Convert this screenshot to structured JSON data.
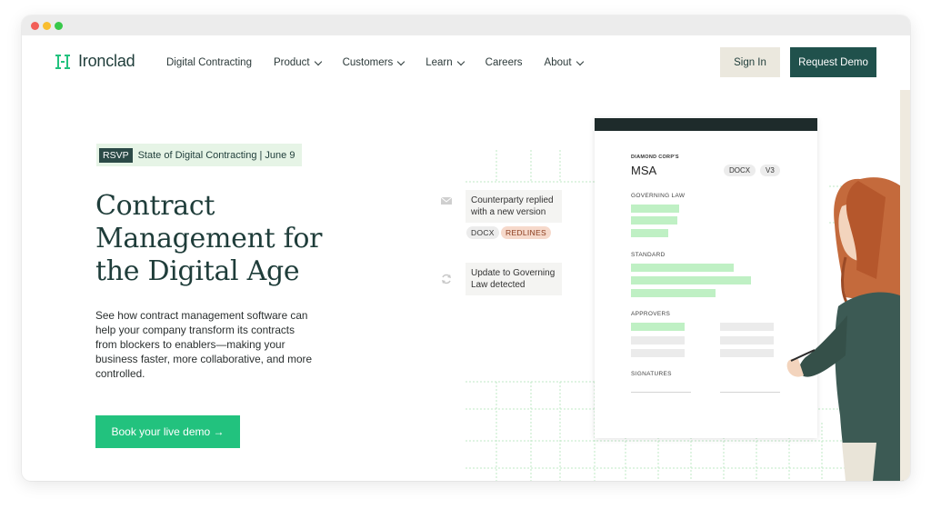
{
  "brand": {
    "name": "Ironclad",
    "accent": "#22c27e",
    "dark": "#20514c"
  },
  "nav": {
    "items": [
      {
        "label": "Digital Contracting",
        "dropdown": false
      },
      {
        "label": "Product",
        "dropdown": true
      },
      {
        "label": "Customers",
        "dropdown": true
      },
      {
        "label": "Learn",
        "dropdown": true
      },
      {
        "label": "Careers",
        "dropdown": false
      },
      {
        "label": "About",
        "dropdown": true
      }
    ],
    "signin_label": "Sign In",
    "demo_label": "Request Demo"
  },
  "hero": {
    "badge_tag": "RSVP",
    "badge_text": "State of Digital Contracting | June 9",
    "headline": "Contract Management for the Digital Age",
    "body": "See how contract management software can help your company transform its contracts from blockers to enablers—making your business faster, more collaborative, and more controlled.",
    "cta_label": "Book your live demo →"
  },
  "illustration": {
    "notification_1": "Counterparty replied with a new version",
    "chip_docx": "DOCX",
    "chip_redlines": "REDLINES",
    "notification_2": "Update to Governing Law detected",
    "doc": {
      "corp": "DIAMOND CORP'S",
      "title": "MSA",
      "chip_format": "DOCX",
      "chip_version": "V3",
      "section_governing": "GOVERNING LAW",
      "section_standard": "STANDARD",
      "section_approvers": "APPROVERS",
      "section_signatures": "SIGNATURES"
    }
  }
}
